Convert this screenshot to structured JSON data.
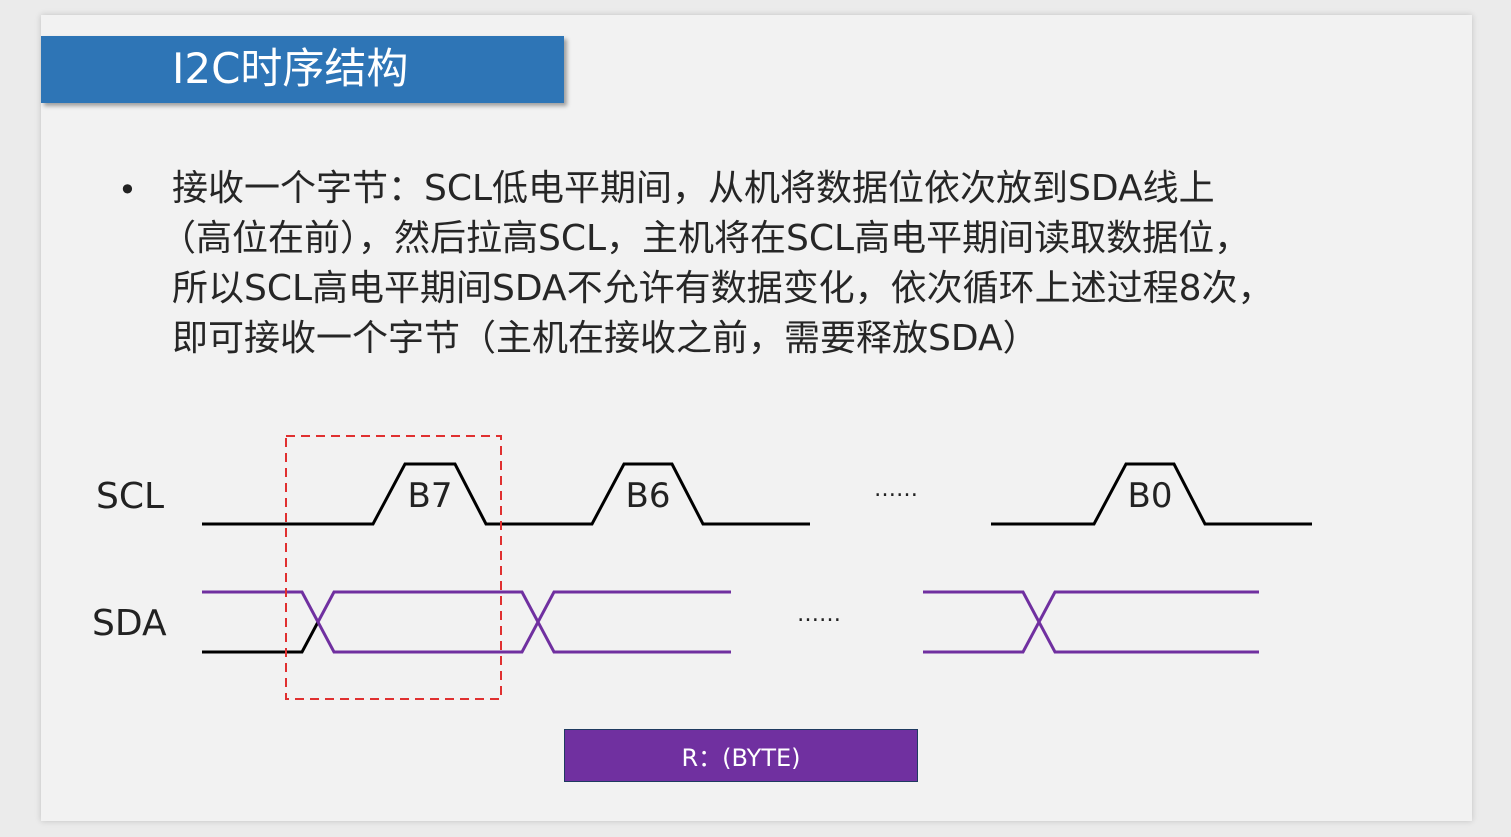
{
  "slide": {
    "title": "I2C时序结构",
    "bullet_lines": [
      "接收一个字节：SCL低电平期间，从机将数据位依次放到SDA线上",
      "（高位在前），然后拉高SCL，主机将在SCL高电平期间读取数据位，",
      "所以SCL高电平期间SDA不允许有数据变化，依次循环上述过程8次，",
      "即可接收一个字节（主机在接收之前，需要释放SDA）"
    ]
  },
  "diagram": {
    "scl_label": "SCL",
    "sda_label": "SDA",
    "bit_labels": [
      "B7",
      "B6",
      "B0"
    ],
    "scl_ellipsis": "……",
    "sda_ellipsis": "……",
    "byte_label": "R：(BYTE)",
    "colors": {
      "scl": "#000000",
      "sda": "#7030a0",
      "highlight": "#e03030",
      "title_bar": "#2e75b6",
      "byte_box": "#7030a0"
    }
  }
}
